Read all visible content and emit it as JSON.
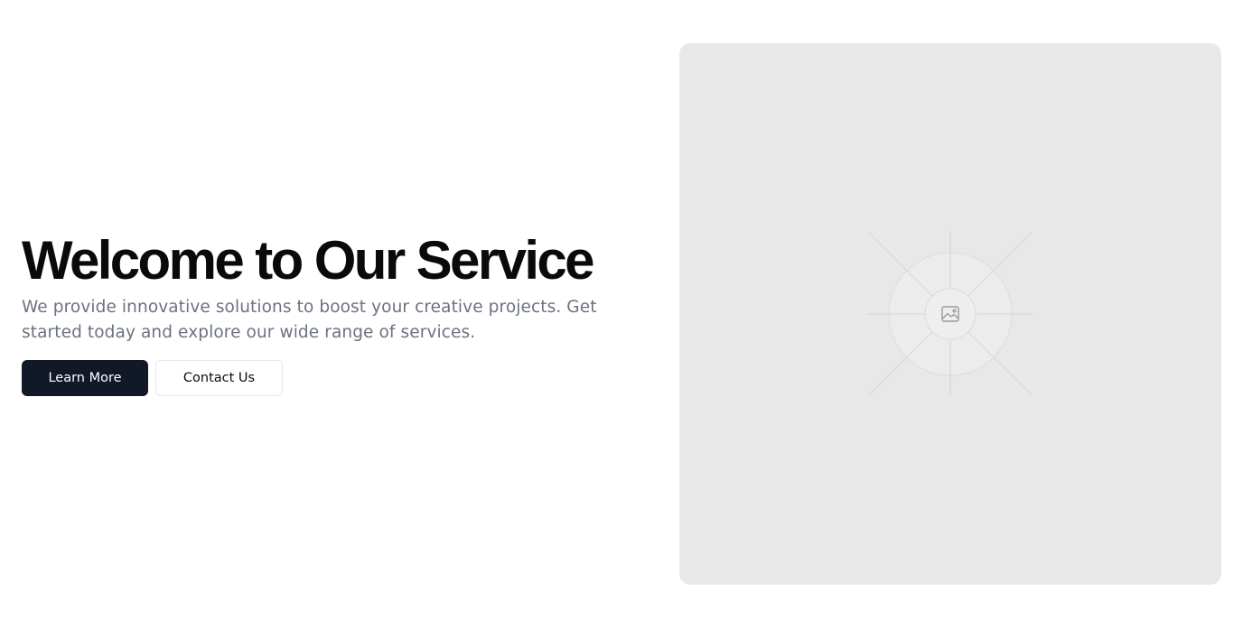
{
  "hero": {
    "title": "Welcome to Our Service",
    "subtitle": "We provide innovative solutions to boost your creative projects. Get started today and explore our wide range of services.",
    "primary_button": "Learn More",
    "secondary_button": "Contact Us"
  },
  "media": {
    "icon": "image-icon",
    "placeholder_color": "#e8e8e8"
  },
  "colors": {
    "primary_button_bg": "#111827",
    "title": "#0a0a0a",
    "subtitle": "#6b7280"
  }
}
